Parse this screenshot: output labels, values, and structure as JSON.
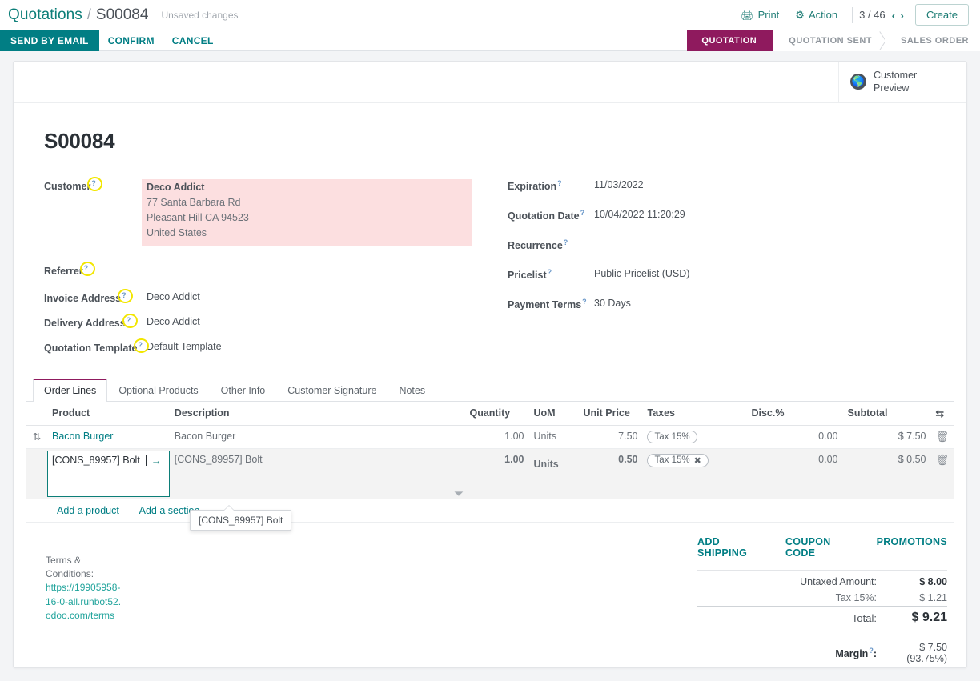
{
  "breadcrumb": {
    "parent": "Quotations",
    "separator": "/",
    "current": "S00084",
    "dirty_status": "Unsaved changes"
  },
  "control_panel": {
    "print_label": "Print",
    "print_icon": "printer-icon",
    "action_label": "Action",
    "action_icon": "gear-icon",
    "pager": "3 / 46",
    "prev_icon": "‹",
    "next_icon": "›",
    "create_label": "Create"
  },
  "statusbar": {
    "buttons": [
      {
        "label": "SEND BY EMAIL",
        "primary": true
      },
      {
        "label": "CONFIRM",
        "primary": false
      },
      {
        "label": "CANCEL",
        "primary": false
      }
    ],
    "stages": [
      {
        "label": "QUOTATION",
        "active": true
      },
      {
        "label": "QUOTATION SENT",
        "active": false
      },
      {
        "label": "SALES ORDER",
        "active": false
      }
    ],
    "active_color": "#8f1a5e"
  },
  "stat_button": {
    "icon": "globe-icon",
    "label_line1": "Customer",
    "label_line2": "Preview"
  },
  "document": {
    "title": "S00084"
  },
  "form": {
    "left": [
      {
        "label": "Customer",
        "help": "?",
        "highlight": true,
        "value_block": {
          "name": "Deco Addict",
          "lines": [
            "77 Santa Barbara Rd",
            "Pleasant Hill CA 94523",
            "United States"
          ]
        }
      },
      {
        "label": "Referrer",
        "help": "?",
        "value": ""
      },
      {
        "label": "Invoice Address",
        "help": "?",
        "value": "Deco Addict"
      },
      {
        "label": "Delivery Address",
        "help": "?",
        "value": "Deco Addict"
      },
      {
        "label": "Quotation Template",
        "help": "?",
        "value": "Default Template"
      }
    ],
    "right": [
      {
        "label": "Expiration",
        "help": "?",
        "value": "11/03/2022"
      },
      {
        "label": "Quotation Date",
        "help": "?",
        "value": "10/04/2022 11:20:29"
      },
      {
        "label": "Recurrence",
        "help": "?",
        "value": ""
      },
      {
        "label": "Pricelist",
        "help": "?",
        "value": "Public Pricelist (USD)"
      },
      {
        "label": "Payment Terms",
        "help": "?",
        "value": "30 Days"
      }
    ]
  },
  "notebook": {
    "tabs": [
      {
        "label": "Order Lines",
        "active": true
      },
      {
        "label": "Optional Products",
        "active": false
      },
      {
        "label": "Other Info",
        "active": false
      },
      {
        "label": "Customer Signature",
        "active": false
      },
      {
        "label": "Notes",
        "active": false
      }
    ]
  },
  "lines_table": {
    "headers": {
      "handle": "",
      "product": "Product",
      "description": "Description",
      "quantity": "Quantity",
      "uom": "UoM",
      "unit_price": "Unit Price",
      "taxes": "Taxes",
      "discount": "Disc.%",
      "subtotal": "Subtotal",
      "options_icon": "column-options-icon"
    },
    "rows": [
      {
        "handle_icon": "drag-handle-icon",
        "product": "Bacon Burger",
        "description": "Bacon Burger",
        "quantity": "1.00",
        "uom": "Units",
        "unit_price": "7.50",
        "tax": "Tax 15%",
        "tax_removable": false,
        "discount": "0.00",
        "subtotal": "$ 7.50",
        "delete_icon": "trash-icon",
        "editing": false
      },
      {
        "handle_icon": "",
        "product": "[CONS_89957] Bolt",
        "description": "[CONS_89957] Bolt",
        "quantity": "1.00",
        "uom": "Units",
        "unit_price": "0.50",
        "tax": "Tax 15%",
        "tax_removable": true,
        "tax_remove_icon": "✖",
        "discount": "0.00",
        "subtotal": "$ 0.50",
        "delete_icon": "trash-icon",
        "editing": true,
        "internal_link_icon": "→"
      }
    ],
    "add_product": "Add a product",
    "add_section": "Add a section",
    "tooltip": "[CONS_89957] Bolt"
  },
  "footer": {
    "terms_label": "Terms & Conditions:",
    "terms_url": "https://19905958-16-0-all.runbot52.odoo.com/terms",
    "promo_links": [
      "ADD SHIPPING",
      "COUPON CODE",
      "PROMOTIONS"
    ],
    "totals": [
      {
        "label": "Untaxed Amount:",
        "value": "$ 8.00",
        "kind": "untaxed"
      },
      {
        "label": "Tax 15%:",
        "value": "$ 1.21",
        "kind": "tax"
      },
      {
        "label": "Total:",
        "value": "$ 9.21",
        "kind": "total"
      },
      {
        "label": "Margin",
        "help": "?",
        "suffix": ":",
        "value": "$ 7.50 (93.75%)",
        "kind": "margin"
      }
    ]
  }
}
